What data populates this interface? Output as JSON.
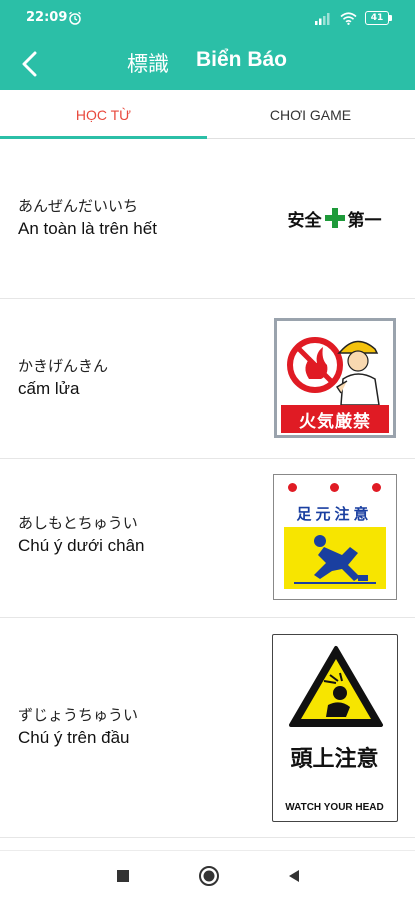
{
  "status_bar": {
    "time": "22:09",
    "battery": "41"
  },
  "app_bar": {
    "title_japanese": "標識",
    "title_vietnamese": "Biển Báo"
  },
  "tabs": [
    {
      "label": "HỌC TỪ",
      "active": true
    },
    {
      "label": "CHƠI GAME",
      "active": false
    }
  ],
  "colors": {
    "accent": "#2bbfa7",
    "active_tab_text": "#e8493d"
  },
  "signs": [
    {
      "kana": "あんぜんだいいち",
      "meaning": "An toàn là trên hết",
      "sign_text_a": "安全",
      "sign_text_b": "第一"
    },
    {
      "kana": "かきげんきん",
      "meaning": "cấm lửa",
      "sign_text": "火気厳禁"
    },
    {
      "kana": "あしもとちゅうい",
      "meaning": "Chú ý dưới chân",
      "sign_text": "足元注意"
    },
    {
      "kana": "ずじょうちゅうい",
      "meaning": "Chú ý trên đầu",
      "sign_text": "頭上注意",
      "sign_subtext": "WATCH YOUR HEAD"
    }
  ],
  "nav_bar": {
    "icons": [
      "square-icon",
      "circle-icon",
      "triangle-back-icon"
    ]
  }
}
